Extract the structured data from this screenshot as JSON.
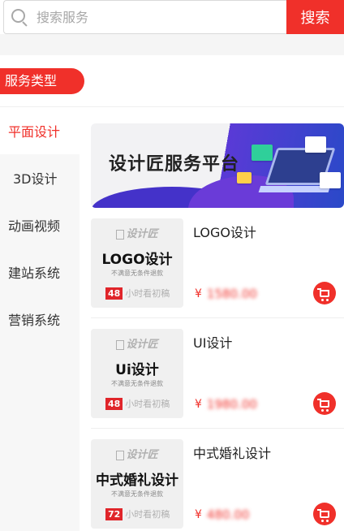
{
  "search": {
    "placeholder": "搜索服务",
    "button_label": "搜索"
  },
  "section": {
    "label": "服务类型"
  },
  "sidebar": {
    "items": [
      {
        "label": "平面设计",
        "active": true
      },
      {
        "label": "3D设计",
        "active": false
      },
      {
        "label": "动画视频",
        "active": false
      },
      {
        "label": "建站系统",
        "active": false
      },
      {
        "label": "营销系统",
        "active": false
      }
    ]
  },
  "banner": {
    "title": "设计匠服务平台"
  },
  "products": [
    {
      "name": "LOGO设计",
      "thumb_brand": "设计匠",
      "thumb_title": "LOGO设计",
      "thumb_subtitle": "不满意无条件退款",
      "thumb_hours_num": "48",
      "thumb_hours_text": "小时看初稿",
      "currency": "¥",
      "price_obscured": "1580.00"
    },
    {
      "name": "UI设计",
      "thumb_brand": "设计匠",
      "thumb_title": "Ui设计",
      "thumb_subtitle": "不满意无条件退款",
      "thumb_hours_num": "48",
      "thumb_hours_text": "小时看初稿",
      "currency": "¥",
      "price_obscured": "1980.00"
    },
    {
      "name": "中式婚礼设计",
      "thumb_brand": "设计匠",
      "thumb_title": "中式婚礼设计",
      "thumb_subtitle": "不满意无条件退款",
      "thumb_hours_num": "72",
      "thumb_hours_text": "小时看初稿",
      "currency": "¥",
      "price_obscured": "480.00"
    }
  ],
  "colors": {
    "accent": "#f0302a",
    "sidebar_bg": "#f7f7f7",
    "thumb_bg": "#f0f0f0"
  },
  "icons": {
    "search": "search-icon",
    "cart": "cart-icon"
  }
}
